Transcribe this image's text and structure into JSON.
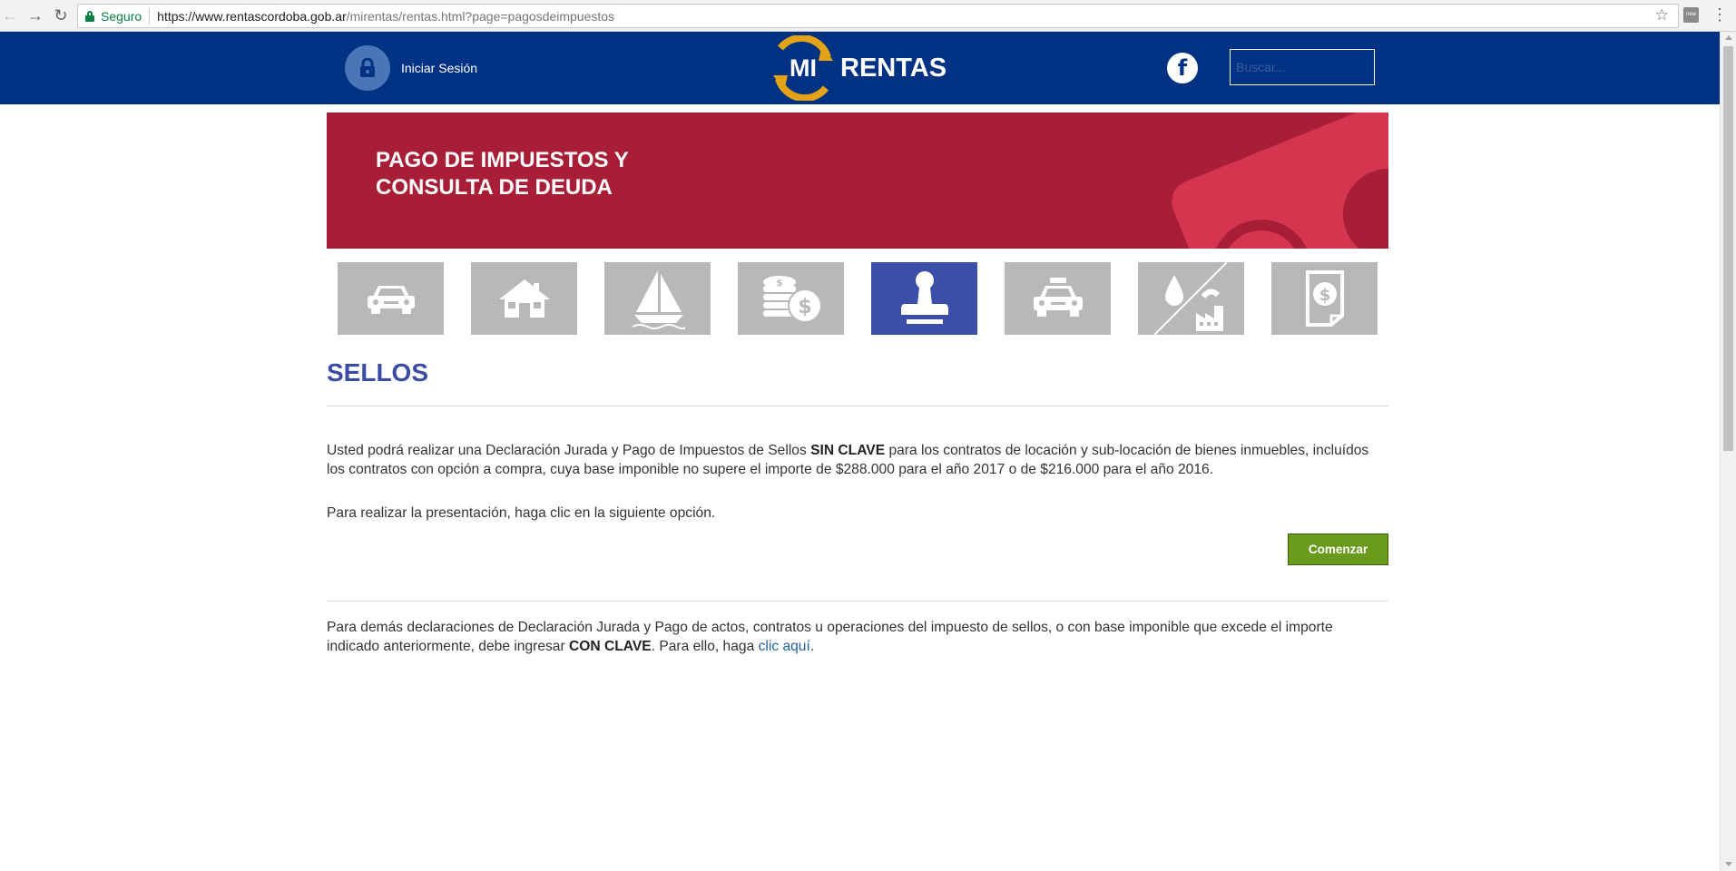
{
  "browser": {
    "secure_label": "Seguro",
    "url_host": "https://www.rentascordoba.gob.ar",
    "url_path": "/mirentas/rentas.html?page=pagosdeimpuestos"
  },
  "header": {
    "login_label": "Iniciar Sesión",
    "logo_mi": "MI",
    "logo_rentas": "RENTAS",
    "facebook_glyph": "f",
    "search_placeholder": "Buscar..."
  },
  "banner": {
    "title_line1": "PAGO DE IMPUESTOS Y",
    "title_line2": "CONSULTA DE DEUDA"
  },
  "tax_tiles": [
    {
      "icon": "car-icon",
      "active": false
    },
    {
      "icon": "house-icon",
      "active": false
    },
    {
      "icon": "sailboat-icon",
      "active": false
    },
    {
      "icon": "coins-icon",
      "active": false
    },
    {
      "icon": "stamp-icon",
      "active": true
    },
    {
      "icon": "taxi-icon",
      "active": false
    },
    {
      "icon": "water-factory-icon",
      "active": false
    },
    {
      "icon": "document-money-icon",
      "active": false
    }
  ],
  "content": {
    "section_title": "SELLOS",
    "para1_a": "Usted podrá realizar una Declaración Jurada y Pago de Impuestos de Sellos ",
    "para1_bold": "SIN CLAVE",
    "para1_b": " para los contratos de locación y sub-locación de bienes inmuebles, incluídos los contratos con opción a compra, cuya base imponible no supere el importe de $288.000 para el año 2017 o de $216.000 para el año 2016.",
    "para2": "Para realizar la presentación, haga clic en la siguiente opción.",
    "start_button": "Comenzar",
    "para3_a": "Para demás declaraciones de Declaración Jurada y Pago de actos, contratos u operaciones del impuesto de sellos, o con base imponible que excede el importe indicado anteriormente, debe ingresar ",
    "para3_bold": "CON CLAVE",
    "para3_b": ". Para ello, haga ",
    "para3_link": "clic aquí",
    "para3_end": "."
  },
  "colors": {
    "header_bg": "#003283",
    "banner_bg": "#a81e36",
    "active_tile": "#3b4fa8",
    "tile_bg": "#b8b8b8",
    "title_color": "#3a4ca3",
    "button_bg": "#6a9a1c",
    "link_color": "#1f5fa3"
  }
}
